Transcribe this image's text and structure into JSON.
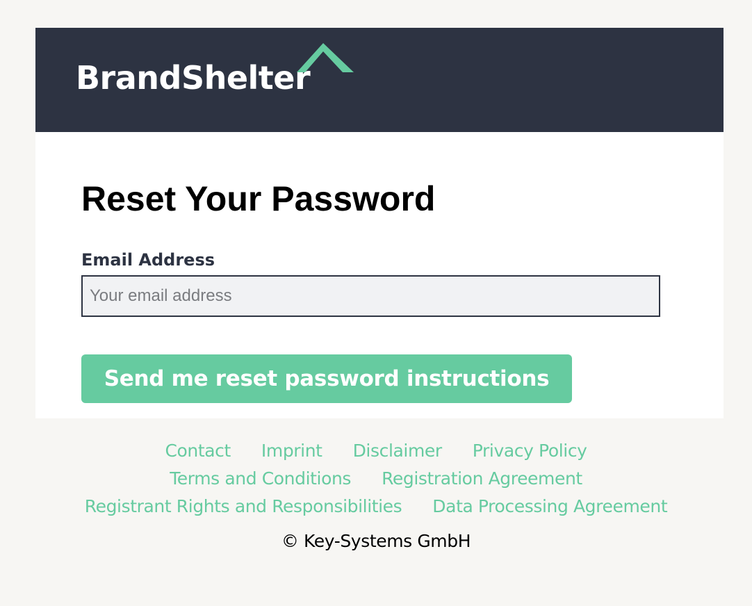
{
  "brand": {
    "name": "BrandShelter",
    "logo_icon": "roof-icon",
    "header_color": "#2d3342",
    "accent_color": "#66cba0"
  },
  "form": {
    "title": "Reset Your Password",
    "email_label": "Email Address",
    "email_value": "",
    "email_placeholder": "Your email address",
    "submit_label": "Send me reset password instructions"
  },
  "footer": {
    "rows": [
      [
        "Contact",
        "Imprint",
        "Disclaimer",
        "Privacy Policy"
      ],
      [
        "Terms and Conditions",
        "Registration Agreement"
      ],
      [
        "Registrant Rights and Responsibilities",
        "Data Processing Agreement"
      ]
    ],
    "copyright": "© Key-Systems GmbH"
  }
}
